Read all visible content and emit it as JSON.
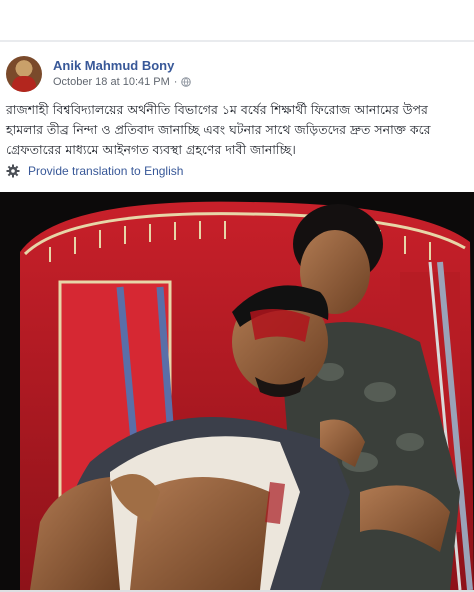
{
  "post": {
    "author": "Anik Mahmud Bony",
    "timestamp": "October 18 at 10:41 PM",
    "separator": "·",
    "privacy_icon": "globe-icon",
    "text": "রাজশাহী বিশ্ববিদ্যালয়ের অর্থনীতি বিভাগের ১ম বর্ষের শিক্ষার্থী ফিরোজ আনামের উপর হামলার তীব্র নিন্দা ও প্রতিবাদ জানাচ্ছি এবং ঘটনার সাথে জড়িতদের দ্রুত সনাক্ত করে গ্রেফতারের মাধ্যমে আইনগত ব্যবস্থা গ্রহণের দাবী জানাচ্ছি।",
    "translate_icon": "gear-icon",
    "translate_label": "Provide translation to English"
  },
  "colors": {
    "link": "#385898",
    "meta": "#616770",
    "text": "#1d2129",
    "background": "#e9ebee"
  }
}
